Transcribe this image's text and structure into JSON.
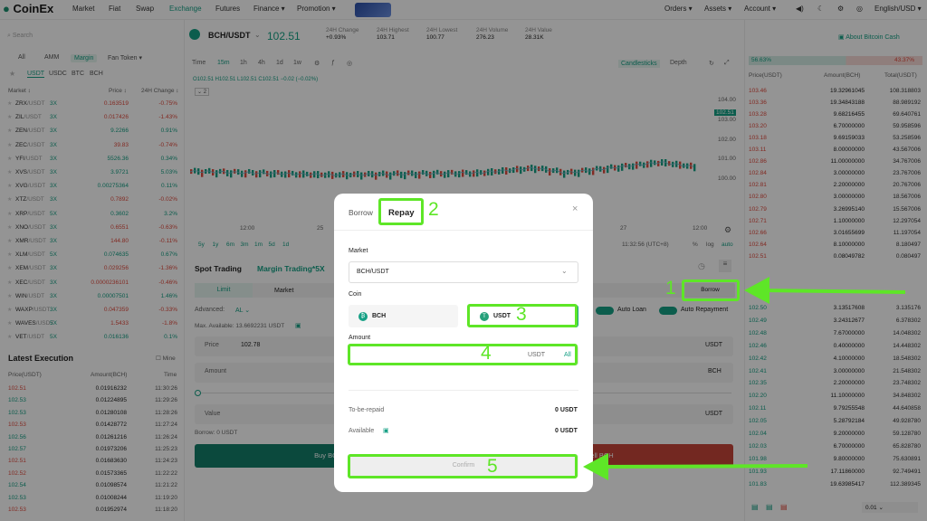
{
  "nav": {
    "logo": "CoinEx",
    "items": [
      "Market",
      "Fiat",
      "Swap",
      "Exchange",
      "Futures",
      "Finance ▾",
      "Promotion ▾"
    ],
    "right_items": [
      "Orders ▾",
      "Assets ▾",
      "Account ▾",
      "English/USD ▾"
    ]
  },
  "left": {
    "search_placeholder": "Search",
    "tabs": [
      "All",
      "AMM",
      "Margin",
      "Fan Token ▾"
    ],
    "quote_tabs": [
      "USDT",
      "USDC",
      "BTC",
      "BCH"
    ],
    "headers": {
      "market": "Market ↕",
      "price": "Price ↕",
      "change": "24H Change ↕"
    },
    "markets": [
      {
        "base": "ZRX",
        "quote": "/USDT",
        "lev": "3X",
        "price": "0.163519",
        "change": "-0.75%",
        "dir": "down"
      },
      {
        "base": "ZIL",
        "quote": "/USDT",
        "lev": "3X",
        "price": "0.017426",
        "change": "-1.43%",
        "dir": "down"
      },
      {
        "base": "ZEN",
        "quote": "/USDT",
        "lev": "3X",
        "price": "9.2266",
        "change": "0.91%",
        "dir": "up"
      },
      {
        "base": "ZEC",
        "quote": "/USDT",
        "lev": "3X",
        "price": "39.83",
        "change": "-0.74%",
        "dir": "down"
      },
      {
        "base": "YFI",
        "quote": "/USDT",
        "lev": "3X",
        "price": "5526.36",
        "change": "0.34%",
        "dir": "up"
      },
      {
        "base": "XVS",
        "quote": "/USDT",
        "lev": "3X",
        "price": "3.9721",
        "change": "5.03%",
        "dir": "up"
      },
      {
        "base": "XVG",
        "quote": "/USDT",
        "lev": "3X",
        "price": "0.00275364",
        "change": "0.11%",
        "dir": "up"
      },
      {
        "base": "XTZ",
        "quote": "/USDT",
        "lev": "3X",
        "price": "0.7892",
        "change": "-0.02%",
        "dir": "down"
      },
      {
        "base": "XRP",
        "quote": "/USDT",
        "lev": "5X",
        "price": "0.3602",
        "change": "3.2%",
        "dir": "up"
      },
      {
        "base": "XNO",
        "quote": "/USDT",
        "lev": "3X",
        "price": "0.6551",
        "change": "-0.63%",
        "dir": "down"
      },
      {
        "base": "XMR",
        "quote": "/USDT",
        "lev": "3X",
        "price": "144.80",
        "change": "-0.11%",
        "dir": "down"
      },
      {
        "base": "XLM",
        "quote": "/USDT",
        "lev": "5X",
        "price": "0.074635",
        "change": "0.67%",
        "dir": "up"
      },
      {
        "base": "XEM",
        "quote": "/USDT",
        "lev": "3X",
        "price": "0.029256",
        "change": "-1.36%",
        "dir": "down"
      },
      {
        "base": "XEC",
        "quote": "/USDT",
        "lev": "3X",
        "price": "0.0000236101",
        "change": "-0.46%",
        "dir": "down"
      },
      {
        "base": "WIN",
        "quote": "/USDT",
        "lev": "3X",
        "price": "0.00007501",
        "change": "1.46%",
        "dir": "up"
      },
      {
        "base": "WAXP",
        "quote": "/USDT",
        "lev": "3X",
        "price": "0.047359",
        "change": "-0.33%",
        "dir": "down"
      },
      {
        "base": "WAVES",
        "quote": "/USDT",
        "lev": "5X",
        "price": "1.5433",
        "change": "-1.8%",
        "dir": "down"
      },
      {
        "base": "VET",
        "quote": "/USDT",
        "lev": "5X",
        "price": "0.016136",
        "change": "0.1%",
        "dir": "up"
      }
    ],
    "latest_title": "Latest Execution",
    "mine_label": "Mine",
    "exec_headers": {
      "price": "Price(USDT)",
      "amount": "Amount(BCH)",
      "time": "Time"
    },
    "executions": [
      {
        "price": "102.51",
        "amount": "0.01916232",
        "time": "11:30:26",
        "dir": "down"
      },
      {
        "price": "102.53",
        "amount": "0.01224895",
        "time": "11:29:26",
        "dir": "up"
      },
      {
        "price": "102.53",
        "amount": "0.01280108",
        "time": "11:28:26",
        "dir": "up"
      },
      {
        "price": "102.53",
        "amount": "0.01428772",
        "time": "11:27:24",
        "dir": "down"
      },
      {
        "price": "102.56",
        "amount": "0.01261216",
        "time": "11:26:24",
        "dir": "up"
      },
      {
        "price": "102.57",
        "amount": "0.01973206",
        "time": "11:25:23",
        "dir": "up"
      },
      {
        "price": "102.51",
        "amount": "0.01683630",
        "time": "11:24:23",
        "dir": "down"
      },
      {
        "price": "102.52",
        "amount": "0.01573365",
        "time": "11:22:22",
        "dir": "down"
      },
      {
        "price": "102.54",
        "amount": "0.01098574",
        "time": "11:21:22",
        "dir": "up"
      },
      {
        "price": "102.53",
        "amount": "0.01008244",
        "time": "11:19:20",
        "dir": "up"
      },
      {
        "price": "102.53",
        "amount": "0.01952974",
        "time": "11:18:20",
        "dir": "down"
      }
    ]
  },
  "ticker": {
    "pair": "BCH/USDT",
    "price": "102.51",
    "stats": [
      {
        "label": "24H Change",
        "value": "+0.93%"
      },
      {
        "label": "24H Highest",
        "value": "103.71"
      },
      {
        "label": "24H Lowest",
        "value": "100.77"
      },
      {
        "label": "24H Volume",
        "value": "276.23"
      },
      {
        "label": "24H Value",
        "value": "28.31K"
      }
    ],
    "about": "About Bitcoin Cash"
  },
  "chart": {
    "toolbar": [
      "Time",
      "15m",
      "1h",
      "4h",
      "1d",
      "1w"
    ],
    "view_tabs": [
      "Candlesticks",
      "Depth"
    ],
    "ohlc": "O102.51 H102.51 L102.51 C102.51 −0.02 (−0.02%)",
    "y_ticks": [
      "104.00",
      "103.00",
      "102.00",
      "101.00",
      "100.00"
    ],
    "last_price_tag": "102.51",
    "x_ticks": [
      "12:00",
      "25",
      "12:00",
      "27",
      "12:00"
    ],
    "ranges": [
      "5y",
      "1y",
      "6m",
      "3m",
      "1m",
      "5d",
      "1d"
    ],
    "time_display": "11:32:56 (UTC+8)",
    "scale_opts": [
      "%",
      "log",
      "auto"
    ]
  },
  "trade": {
    "tabs": [
      "Spot Trading",
      "Margin Trading*5X"
    ],
    "order_tabs": [
      "Limit",
      "Market"
    ],
    "advanced": "Advanced:",
    "advanced_val": "AL",
    "max_avail": "Max. Available: 13.6692231 USDT",
    "price_label": "Price",
    "price_val": "102.78",
    "price_unit": "USDT",
    "amount_label": "Amount",
    "amount_unit": "BCH",
    "value_label": "Value",
    "value_unit": "USDT",
    "borrow_info": "Borrow: 0 USDT",
    "buy_label": "Buy BCH",
    "sell_label": "Sell BCH",
    "borrow_btn": "Borrow",
    "auto_loan": "Auto Loan",
    "auto_repay": "Auto Repayment"
  },
  "orderbook": {
    "pct_buy": "56.63%",
    "pct_sell": "43.37%",
    "headers": {
      "price": "Price(USDT)",
      "amount": "Amount(BCH)",
      "total": "Total(USDT)"
    },
    "asks": [
      {
        "price": "103.46",
        "amount": "19.32961045",
        "total": "108.318803"
      },
      {
        "price": "103.36",
        "amount": "19.34843188",
        "total": "88.989192"
      },
      {
        "price": "103.28",
        "amount": "9.68216455",
        "total": "69.640761"
      },
      {
        "price": "103.20",
        "amount": "6.70000000",
        "total": "59.958596"
      },
      {
        "price": "103.18",
        "amount": "9.69159033",
        "total": "53.258596"
      },
      {
        "price": "103.11",
        "amount": "8.00000000",
        "total": "43.567006"
      },
      {
        "price": "102.86",
        "amount": "11.00000000",
        "total": "34.767006"
      },
      {
        "price": "102.84",
        "amount": "3.00000000",
        "total": "23.767006"
      },
      {
        "price": "102.81",
        "amount": "2.20000000",
        "total": "20.767006"
      },
      {
        "price": "102.80",
        "amount": "3.00000000",
        "total": "18.567006"
      },
      {
        "price": "102.79",
        "amount": "3.26995140",
        "total": "15.567006"
      },
      {
        "price": "102.71",
        "amount": "1.10000000",
        "total": "12.297054"
      },
      {
        "price": "102.66",
        "amount": "3.01655699",
        "total": "11.197054"
      },
      {
        "price": "102.64",
        "amount": "8.10000000",
        "total": "8.180497"
      },
      {
        "price": "102.51",
        "amount": "0.08049782",
        "total": "0.080497"
      }
    ],
    "bids": [
      {
        "price": "102.50",
        "amount": "3.13517608",
        "total": "3.135176"
      },
      {
        "price": "102.49",
        "amount": "3.24312677",
        "total": "6.378302"
      },
      {
        "price": "102.48",
        "amount": "7.67000000",
        "total": "14.048302"
      },
      {
        "price": "102.46",
        "amount": "0.40000000",
        "total": "14.448302"
      },
      {
        "price": "102.42",
        "amount": "4.10000000",
        "total": "18.548302"
      },
      {
        "price": "102.41",
        "amount": "3.00000000",
        "total": "21.548302"
      },
      {
        "price": "102.35",
        "amount": "2.20000000",
        "total": "23.748302"
      },
      {
        "price": "102.20",
        "amount": "11.10000000",
        "total": "34.848302"
      },
      {
        "price": "102.11",
        "amount": "9.79255548",
        "total": "44.640858"
      },
      {
        "price": "102.05",
        "amount": "5.28792184",
        "total": "49.928780"
      },
      {
        "price": "102.04",
        "amount": "9.20000000",
        "total": "59.128780"
      },
      {
        "price": "102.03",
        "amount": "6.70000000",
        "total": "65.828780"
      },
      {
        "price": "101.98",
        "amount": "9.80000000",
        "total": "75.630891"
      },
      {
        "price": "101.93",
        "amount": "17.11860000",
        "total": "92.749491"
      },
      {
        "price": "101.83",
        "amount": "19.63985417",
        "total": "112.389345"
      }
    ],
    "precision": "0.01"
  },
  "modal": {
    "tab_borrow": "Borrow",
    "tab_repay": "Repay",
    "close": "×",
    "market_label": "Market",
    "market_value": "BCH/USDT",
    "coin_label": "Coin",
    "coin_bch": "BCH",
    "coin_usdt": "USDT",
    "amount_label": "Amount",
    "amount_unit": "USDT",
    "amount_all": "All",
    "to_repay_label": "To-be-repaid",
    "to_repay_value": "0 USDT",
    "available_label": "Available",
    "available_value": "0 USDT",
    "confirm": "Confirm"
  },
  "annotations": [
    "1",
    "2",
    "3",
    "4",
    "5"
  ],
  "colors": {
    "accent": "#16a085",
    "up": "#16a085",
    "down": "#e04b3e",
    "highlight": "#5ee627"
  }
}
